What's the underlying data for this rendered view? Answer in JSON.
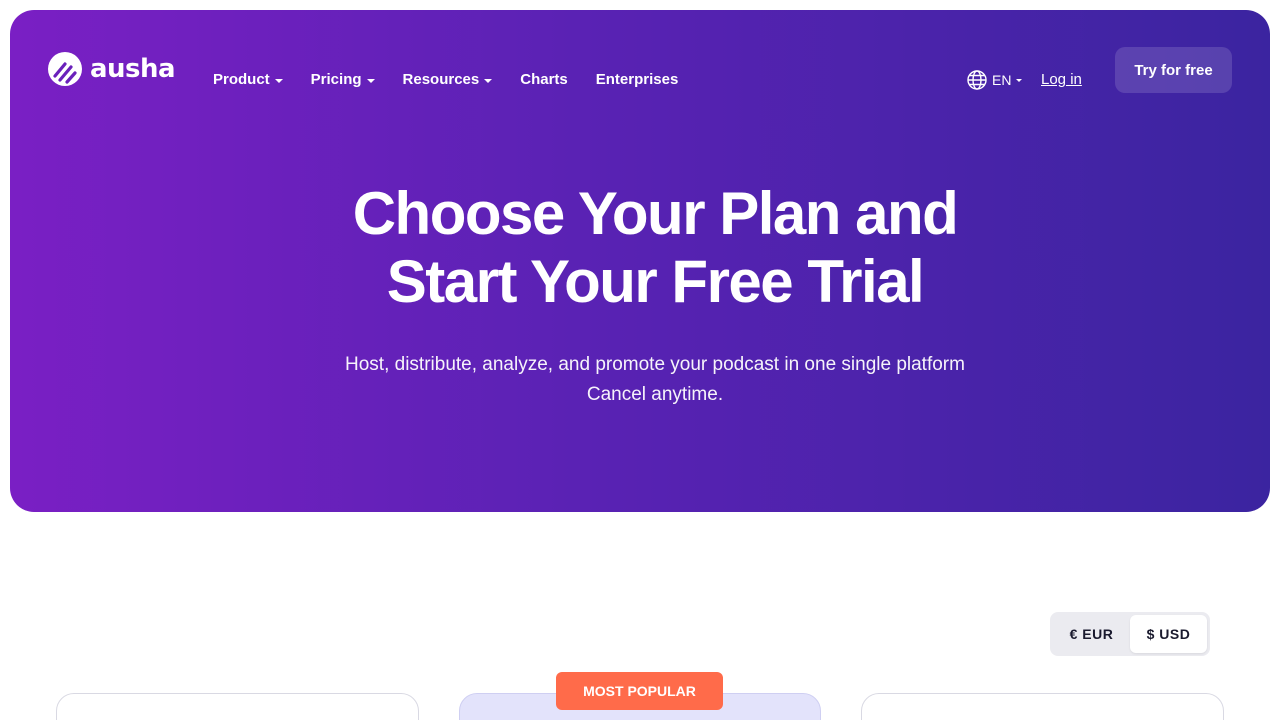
{
  "brand": {
    "name": "ausha"
  },
  "nav": {
    "items": [
      {
        "label": "Product",
        "dropdown": true
      },
      {
        "label": "Pricing",
        "dropdown": true
      },
      {
        "label": "Resources",
        "dropdown": true
      },
      {
        "label": "Charts",
        "dropdown": false
      },
      {
        "label": "Enterprises",
        "dropdown": false
      }
    ],
    "language": "EN",
    "login": "Log in",
    "cta": "Try for free"
  },
  "hero": {
    "title_line1": "Choose Your Plan and",
    "title_line2": "Start Your Free Trial",
    "subtitle_line1": "Host, distribute, analyze, and promote your podcast in one single platform",
    "subtitle_line2": "Cancel anytime."
  },
  "pricing": {
    "currency_options": [
      "€ EUR",
      "$ USD"
    ],
    "selected_currency": "$ USD",
    "badge": "MOST POPULAR"
  },
  "colors": {
    "hero_gradient_start": "#7a1fc4",
    "hero_gradient_end": "#3b24a0",
    "badge": "#ff6b4a",
    "featured_card": "#e3e3fb"
  }
}
